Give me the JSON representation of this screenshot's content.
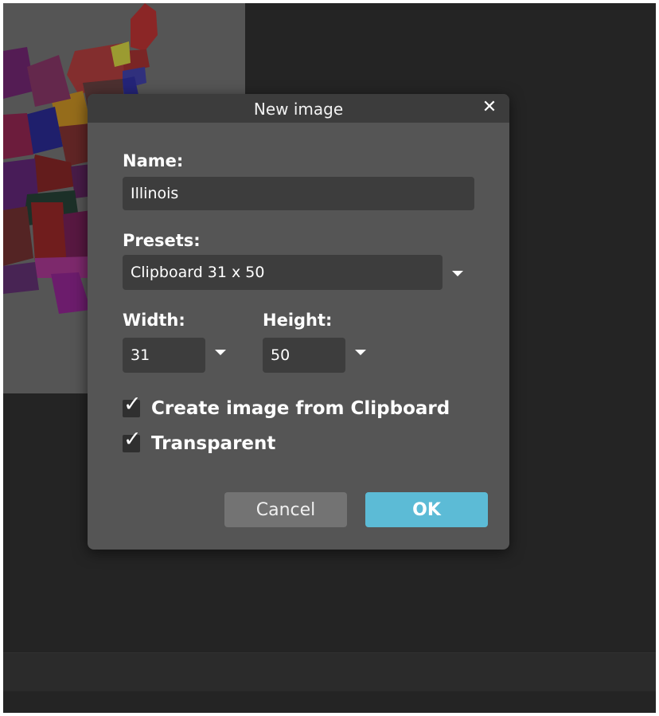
{
  "dialog": {
    "title": "New image",
    "close_glyph": "✕",
    "name_label": "Name:",
    "name_value": "Illinois",
    "presets_label": "Presets:",
    "presets_value": "Clipboard 31 x 50",
    "width_label": "Width:",
    "width_value": "31",
    "height_label": "Height:",
    "height_value": "50",
    "checkboxes": [
      {
        "label": "Create image from Clipboard",
        "checked": true
      },
      {
        "label": "Transparent",
        "checked": true
      }
    ],
    "check_glyph": "✓",
    "cancel_label": "Cancel",
    "ok_label": "OK"
  },
  "icons": {
    "close": "close-icon",
    "dropdown": "chevron-down-icon",
    "check": "checkmark-icon"
  },
  "colors": {
    "ok_button": "#5cbbd6",
    "dialog_bg": "#555555",
    "workspace_bg": "#242424"
  }
}
